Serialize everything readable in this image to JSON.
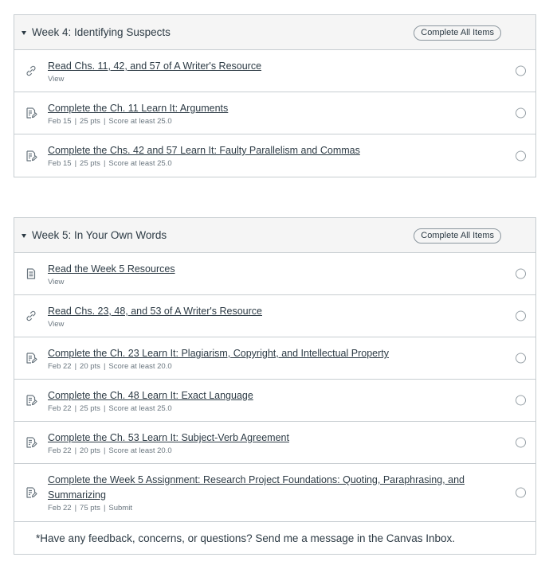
{
  "modules": [
    {
      "title": "Week 4: Identifying Suspects",
      "complete_all_label": "Complete All Items",
      "items": [
        {
          "icon": "link-icon",
          "title": "Read Chs. 11, 42, and 57 of A Writer's Resource",
          "meta": [
            "View"
          ]
        },
        {
          "icon": "assignment-icon",
          "title": "Complete the Ch. 11 Learn It: Arguments",
          "meta": [
            "Feb 15",
            "25 pts",
            "Score at least 25.0"
          ]
        },
        {
          "icon": "assignment-icon",
          "title": "Complete the Chs. 42 and 57 Learn It: Faulty Parallelism and Commas",
          "meta": [
            "Feb 15",
            "25 pts",
            "Score at least 25.0"
          ]
        }
      ]
    },
    {
      "title": "Week 5: In Your Own Words",
      "complete_all_label": "Complete All Items",
      "items": [
        {
          "icon": "page-icon",
          "title": "Read the Week 5 Resources",
          "meta": [
            "View"
          ]
        },
        {
          "icon": "link-icon",
          "title": "Read Chs. 23, 48, and 53 of A Writer's Resource",
          "meta": [
            "View"
          ]
        },
        {
          "icon": "assignment-icon",
          "title": "Complete the Ch. 23 Learn It: Plagiarism, Copyright, and Intellectual Property",
          "meta": [
            "Feb 22",
            "20 pts",
            "Score at least 20.0"
          ]
        },
        {
          "icon": "assignment-icon",
          "title": "Complete the Ch. 48 Learn It: Exact Language",
          "meta": [
            "Feb 22",
            "25 pts",
            "Score at least 25.0"
          ]
        },
        {
          "icon": "assignment-icon",
          "title": "Complete the Ch. 53 Learn It: Subject-Verb Agreement",
          "meta": [
            "Feb 22",
            "20 pts",
            "Score at least 20.0"
          ]
        },
        {
          "icon": "assignment-icon",
          "title": "Complete the Week 5 Assignment: Research Project Foundations: Quoting, Paraphrasing, and Summarizing",
          "meta": [
            "Feb 22",
            "75 pts",
            "Submit"
          ]
        }
      ],
      "feedback": "*Have any feedback, concerns, or questions? Send me a message in the Canvas Inbox."
    }
  ]
}
